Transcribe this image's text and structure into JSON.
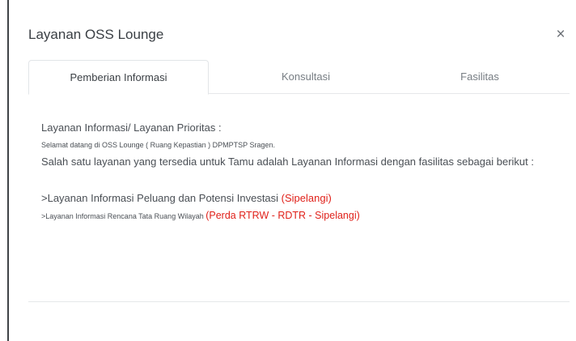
{
  "modal": {
    "title": "Layanan OSS Lounge",
    "close_symbol": "×"
  },
  "tabs": [
    {
      "label": "Pemberian Informasi",
      "active": true
    },
    {
      "label": "Konsultasi",
      "active": false
    },
    {
      "label": "Fasilitas",
      "active": false
    }
  ],
  "content": {
    "heading": "Layanan Informasi/ Layanan Prioritas :",
    "welcome": "Selamat datang di OSS Lounge ( Ruang Kepastian ) DPMPTSP Sragen.",
    "intro": "Salah satu layanan yang tersedia untuk Tamu adalah Layanan Informasi dengan fasilitas sebagai berikut :",
    "items": [
      {
        "text": ">Layanan Informasi Peluang dan Potensi Investasi ",
        "highlight": " (Sipelangi)"
      },
      {
        "text": ">Layanan Informasi Rencana Tata Ruang Wilayah ",
        "highlight": "(Perda RTRW - RDTR - Sipelangi)"
      }
    ]
  },
  "colors": {
    "accent_red": "#e0211a",
    "text": "#4a4f55"
  }
}
